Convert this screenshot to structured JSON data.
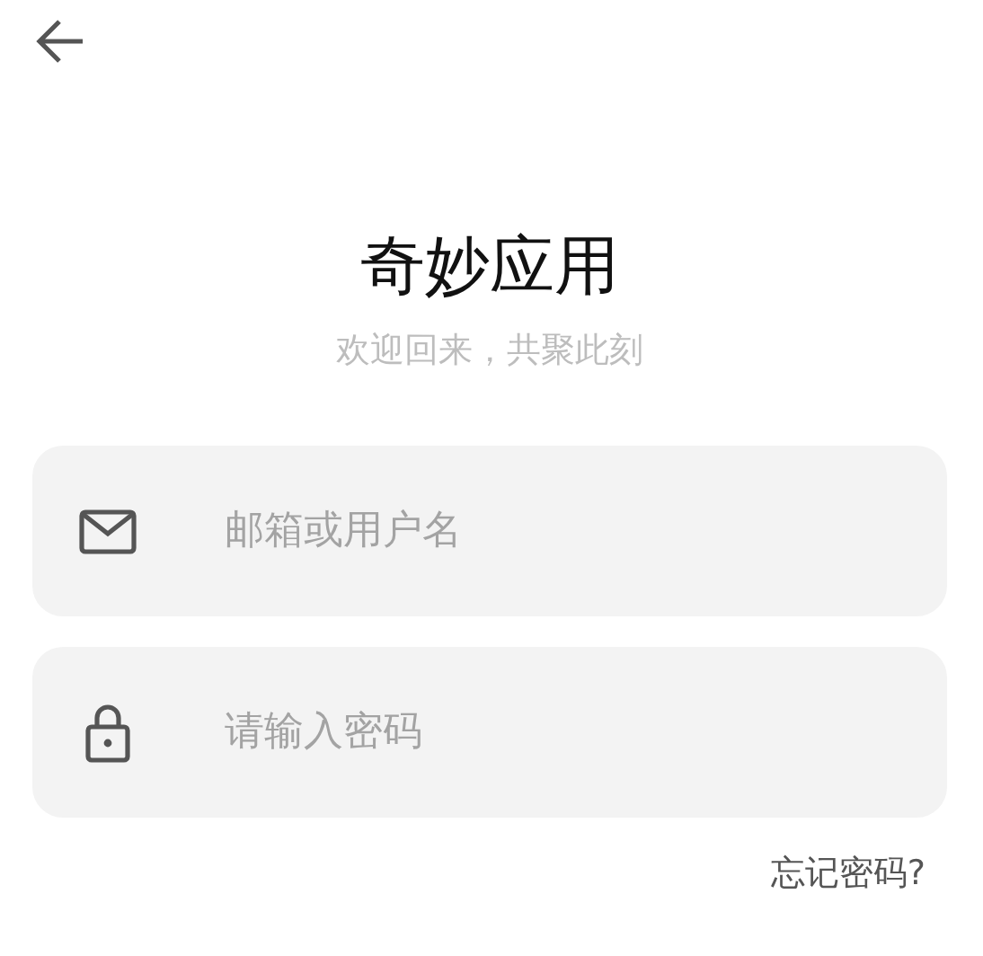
{
  "title": "奇妙应用",
  "subtitle": "欢迎回来，共聚此刻",
  "fields": [
    {
      "kind": "email",
      "placeholder": "邮箱或用户名"
    },
    {
      "kind": "password",
      "placeholder": "请输入密码"
    }
  ],
  "forgot_link": "忘记密码?"
}
